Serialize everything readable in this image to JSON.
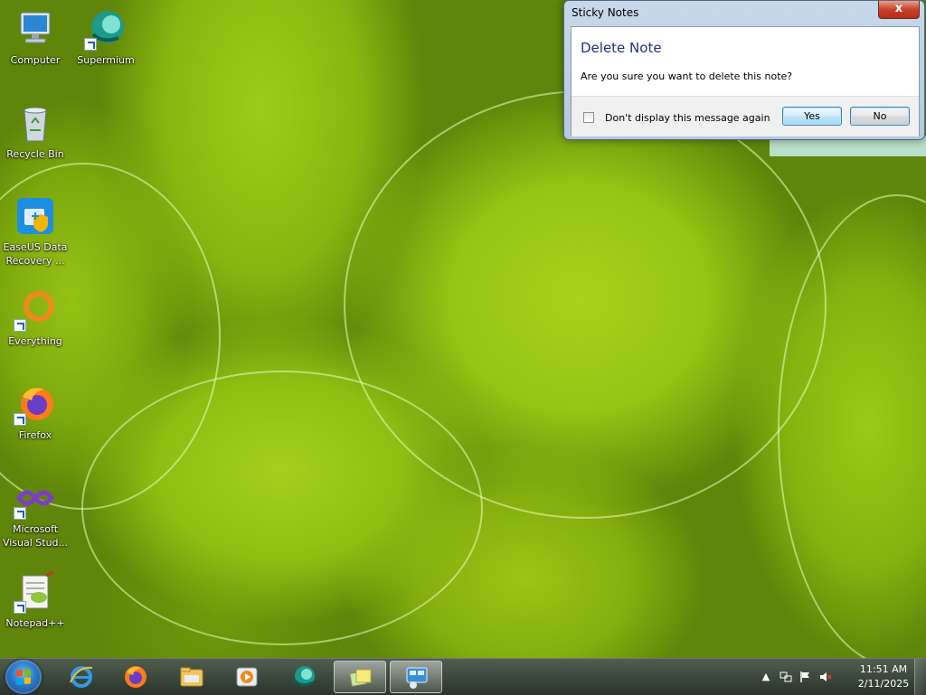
{
  "desktop": {
    "icons": [
      {
        "label": "Computer",
        "icon": "computer-icon"
      },
      {
        "label": "Supermium",
        "icon": "supermium-icon"
      },
      {
        "label": "Recycle Bin",
        "icon": "recycle-bin-icon"
      },
      {
        "label": "EaseUS Data Recovery ...",
        "icon": "easeus-icon"
      },
      {
        "label": "Everything",
        "icon": "everything-icon"
      },
      {
        "label": "Firefox",
        "icon": "firefox-icon"
      },
      {
        "label": "Microsoft Visual Stud...",
        "icon": "visual-studio-icon"
      },
      {
        "label": "Notepad++",
        "icon": "notepadpp-icon"
      }
    ]
  },
  "dialog": {
    "title": "Sticky Notes",
    "close_label": "x",
    "heading": "Delete Note",
    "message": "Are you sure you want to delete this note?",
    "checkbox_label": "Don't display this message again",
    "checkbox_checked": false,
    "yes_label": "Yes",
    "no_label": "No"
  },
  "taskbar": {
    "pinned": [
      {
        "name": "internet-explorer-icon"
      },
      {
        "name": "firefox-icon"
      },
      {
        "name": "file-explorer-icon"
      },
      {
        "name": "media-player-icon"
      },
      {
        "name": "supermium-icon"
      },
      {
        "name": "sticky-notes-icon"
      },
      {
        "name": "remote-desktop-icon"
      }
    ],
    "clock": {
      "time": "11:51 AM",
      "date": "2/11/2025"
    }
  },
  "colors": {
    "dialog_heading": "#1e3287",
    "taskbar": "#2f3d2f",
    "wallpaper_green": "#8fbd12"
  }
}
